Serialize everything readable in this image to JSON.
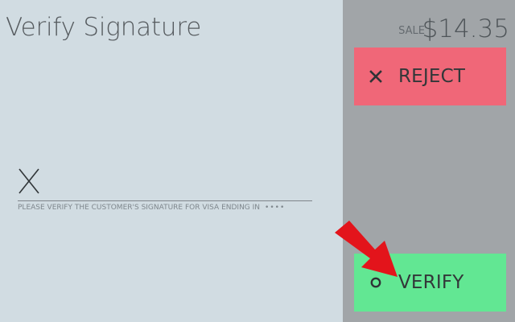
{
  "header": {
    "title": "Verify Signature"
  },
  "signature": {
    "mark": "X",
    "instruction": "PLEASE VERIFY THE CUSTOMER'S SIGNATURE FOR VISA ENDING IN",
    "masked_card_digits": "••••"
  },
  "transaction": {
    "label": "SALE",
    "amount": "$14.35"
  },
  "actions": {
    "reject": {
      "label": "REJECT",
      "icon": "close-icon"
    },
    "verify": {
      "label": "VERIFY",
      "icon": "circle-icon"
    }
  },
  "colors": {
    "left_panel": "#d1dce2",
    "right_panel": "#a1a5a8",
    "reject": "#f06778",
    "verify": "#62e793",
    "annotation_arrow": "#e3141b"
  },
  "annotation": {
    "icon": "red-arrow-icon"
  }
}
